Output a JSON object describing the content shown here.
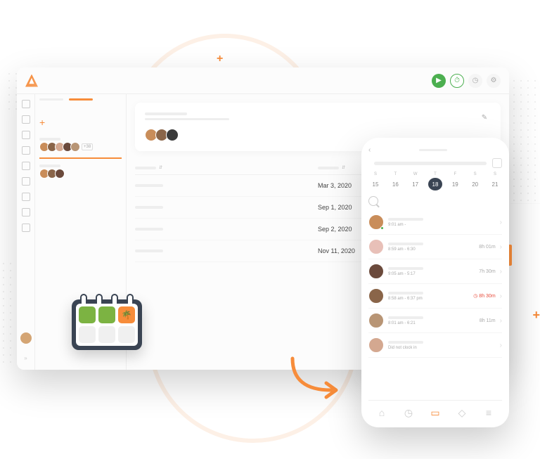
{
  "dash": {
    "more": "+38",
    "rows": [
      {
        "date": "Mar 3, 2020"
      },
      {
        "date": "Sep 1, 2020"
      },
      {
        "date": "Sep 2, 2020"
      },
      {
        "date": "Nov 11, 2020"
      }
    ]
  },
  "phone": {
    "week": [
      "S",
      "T",
      "W",
      "T",
      "F",
      "S",
      "S"
    ],
    "dates": [
      "15",
      "16",
      "17",
      "18",
      "19",
      "20",
      "21"
    ],
    "today": "18",
    "items": [
      {
        "time": "9:01 am -",
        "dur": "",
        "av": "#c98d5a"
      },
      {
        "time": "8:59 am - 6:30",
        "dur": "8h 01m",
        "av": "#e8c0b8"
      },
      {
        "time": "9:05 am - 5:17",
        "dur": "7h 30m",
        "av": "#6b4a3c"
      },
      {
        "time": "8:58 am - 6:37 pm",
        "dur": "8h 30m",
        "red": true,
        "av": "#8a6549"
      },
      {
        "time": "8:01 am - 6:21",
        "dur": "8h 11m",
        "av": "#b89575"
      },
      {
        "time": "Did not clock in",
        "dur": "",
        "av": "#d4a890"
      }
    ]
  },
  "icons": {
    "play": "▶",
    "run": "⏱",
    "clock": "◷",
    "settings": "⚙",
    "edit": "✎",
    "home": "⌂",
    "timer": "◷",
    "doc": "▭",
    "shield": "◇",
    "menu": "≡",
    "palm": "🌴",
    "caret": "›",
    "red_clock": "◷"
  }
}
